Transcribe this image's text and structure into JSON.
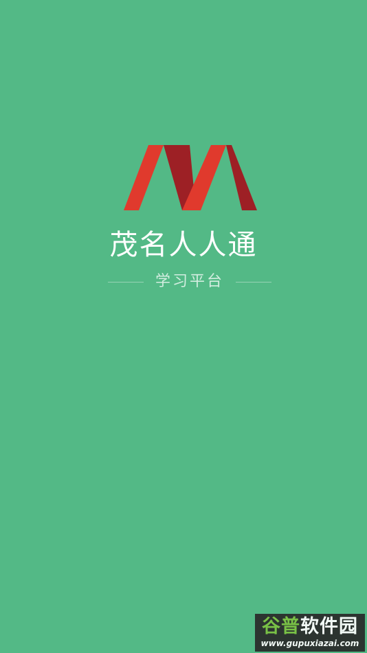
{
  "app": {
    "title": "茂名人人通",
    "subtitle": "学习平台"
  },
  "logo": {
    "icon": "m-ribbon-logo-icon",
    "colors": {
      "light_red": "#e03a2d",
      "dark_red": "#9d2025"
    }
  },
  "watermark": {
    "brand_part1": "谷普",
    "brand_part2": "软件园",
    "url": "www.gupuxiazai.com",
    "colors": {
      "brand_part1": "#7cc242",
      "brand_part2": "#ffffff",
      "url": "#ffffff"
    }
  },
  "colors": {
    "background": "#53b986",
    "title_text": "#ffffff",
    "subtitle_text": "#eaf7f0",
    "divider": "#eaf7f0"
  }
}
